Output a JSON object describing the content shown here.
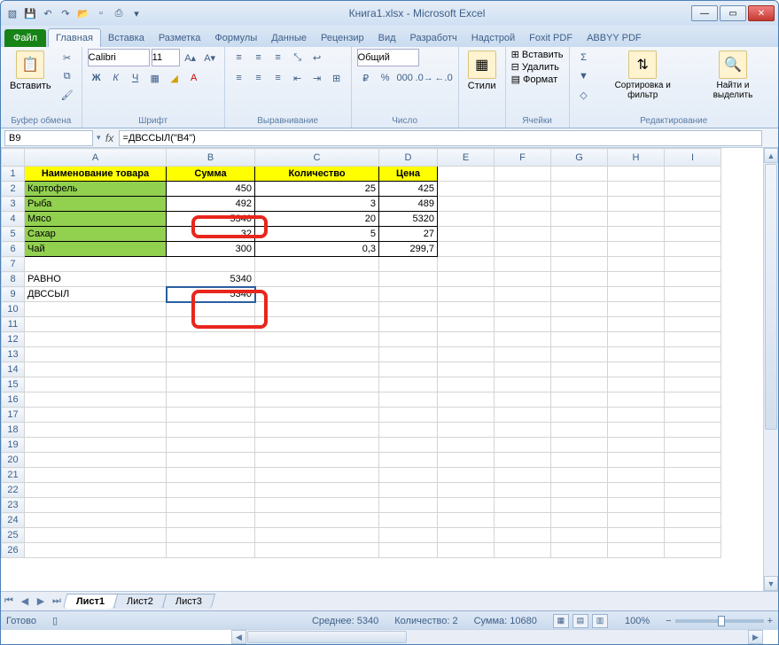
{
  "window": {
    "title": "Книга1.xlsx - Microsoft Excel"
  },
  "qat": {
    "save": "💾",
    "undo": "↶",
    "redo": "↷",
    "open": "📂",
    "new": "▫",
    "print": "⎙"
  },
  "tabs": {
    "file": "Файл",
    "items": [
      "Главная",
      "Вставка",
      "Разметка",
      "Формулы",
      "Данные",
      "Рецензир",
      "Вид",
      "Разработч",
      "Надстрой",
      "Foxit PDF",
      "ABBYY PDF"
    ],
    "active": 0
  },
  "ribbon": {
    "clipboard": {
      "paste": "Вставить",
      "label": "Буфер обмена"
    },
    "font": {
      "name": "Calibri",
      "size": "11",
      "label": "Шрифт"
    },
    "align": {
      "label": "Выравнивание"
    },
    "number": {
      "format": "Общий",
      "label": "Число"
    },
    "styles": {
      "btn": "Стили",
      "label": ""
    },
    "cells": {
      "insert": "Вставить",
      "delete": "Удалить",
      "format": "Формат",
      "label": "Ячейки"
    },
    "editing": {
      "sort": "Сортировка и фильтр",
      "find": "Найти и выделить",
      "label": "Редактирование"
    }
  },
  "namebox": "B9",
  "formula": "=ДВССЫЛ(\"B4\")",
  "columns": [
    "A",
    "B",
    "C",
    "D",
    "E",
    "F",
    "G",
    "H",
    "I"
  ],
  "headers": {
    "name": "Наименование товара",
    "sum": "Сумма",
    "qty": "Количество",
    "price": "Цена"
  },
  "rows": [
    {
      "name": "Картофель",
      "sum": "450",
      "qty": "25",
      "price": "425"
    },
    {
      "name": "Рыба",
      "sum": "492",
      "qty": "3",
      "price": "489"
    },
    {
      "name": "Мясо",
      "sum": "5340",
      "qty": "20",
      "price": "5320"
    },
    {
      "name": "Сахар",
      "sum": "32",
      "qty": "5",
      "price": "27"
    },
    {
      "name": "Чай",
      "sum": "300",
      "qty": "0,3",
      "price": "299,7"
    }
  ],
  "extra": [
    {
      "label": "РАВНО",
      "val": "5340"
    },
    {
      "label": "ДВССЫЛ",
      "val": "5340"
    }
  ],
  "sheetTabs": [
    "Лист1",
    "Лист2",
    "Лист3"
  ],
  "status": {
    "ready": "Готово",
    "avg_lbl": "Среднее:",
    "avg": "5340",
    "count_lbl": "Количество:",
    "count": "2",
    "sum_lbl": "Сумма:",
    "sum": "10680",
    "zoom": "100%"
  }
}
